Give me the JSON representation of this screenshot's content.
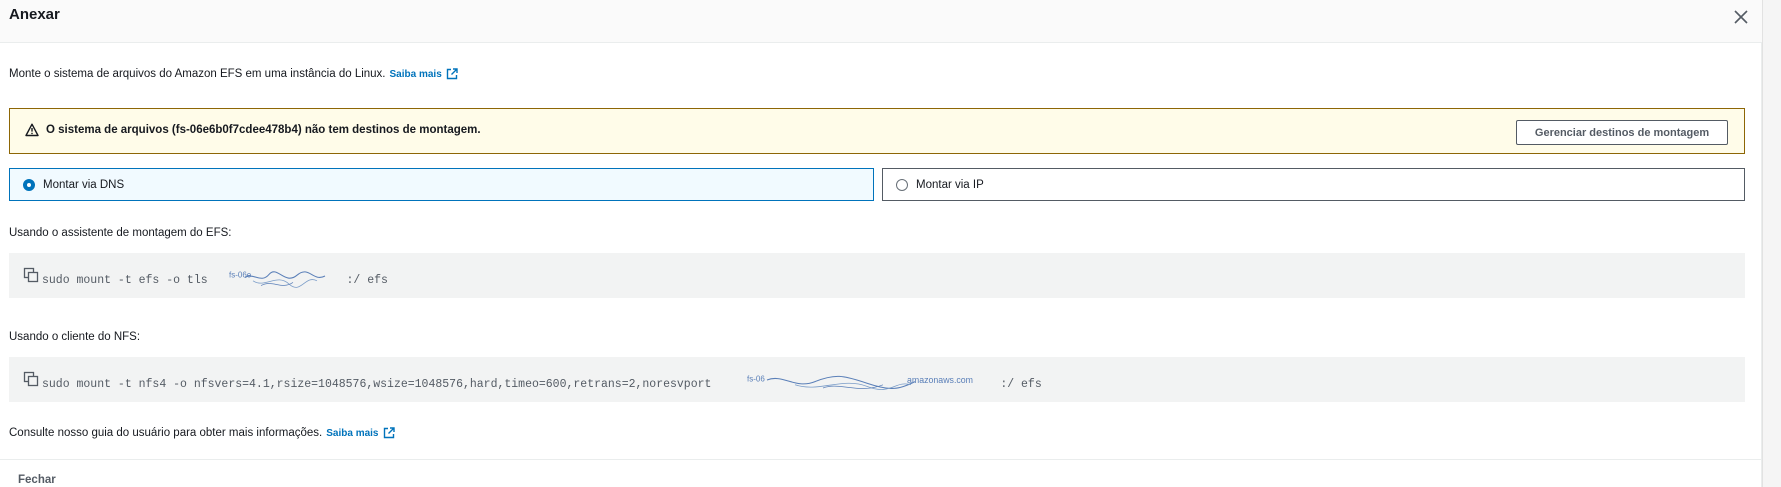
{
  "modal": {
    "title": "Anexar",
    "close_icon": "close-icon"
  },
  "intro": {
    "text": "Monte o sistema de arquivos do Amazon EFS em uma instância do Linux.",
    "link_label": "Saiba mais",
    "link_icon": "external-link-icon"
  },
  "alert": {
    "icon": "warning-icon",
    "message": "O sistema de arquivos (fs-06e6b0f7cdee478b4) não tem destinos de montagem.",
    "button_label": "Gerenciar destinos de montagem"
  },
  "mount_options": {
    "selected": "dns",
    "dns_label": "Montar via DNS",
    "ip_label": "Montar via IP"
  },
  "efs_helper": {
    "label": "Usando o assistente de montagem do EFS:",
    "command_prefix": "sudo mount -t efs -o tls ",
    "command_suffix": ":/ efs"
  },
  "nfs_client": {
    "label": "Usando o cliente do NFS:",
    "command_prefix": "sudo mount -t nfs4 -o nfsvers=4.1,rsize=1048576,wsize=1048576,hard,timeo=600,retrans=2,noresvport ",
    "command_suffix": ":/ efs"
  },
  "footer": {
    "text": "Consulte nosso guia do usuário para obter mais informações.",
    "link_label": "Saiba mais",
    "close_label": "Fechar"
  },
  "colors": {
    "link": "#0073bb",
    "alert_border": "#8d6605",
    "alert_bg": "#fffce9",
    "selected_tile_bg": "#f1faff"
  }
}
